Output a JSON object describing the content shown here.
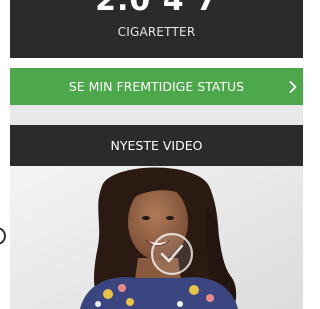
{
  "stats": {
    "count_partial": "2.0 4 7",
    "count_label": "CIGARETTER"
  },
  "status_button": {
    "label": "SE MIN FREMTIDIGE STATUS",
    "icon": "chevron-right-icon"
  },
  "video_section": {
    "header": "NYESTE VIDEO",
    "play_icon": "play-check-icon"
  },
  "colors": {
    "dark_panel": "#2b2b2d",
    "accent_green": "#4ca84a",
    "divider_gray": "#e8e8e8"
  }
}
